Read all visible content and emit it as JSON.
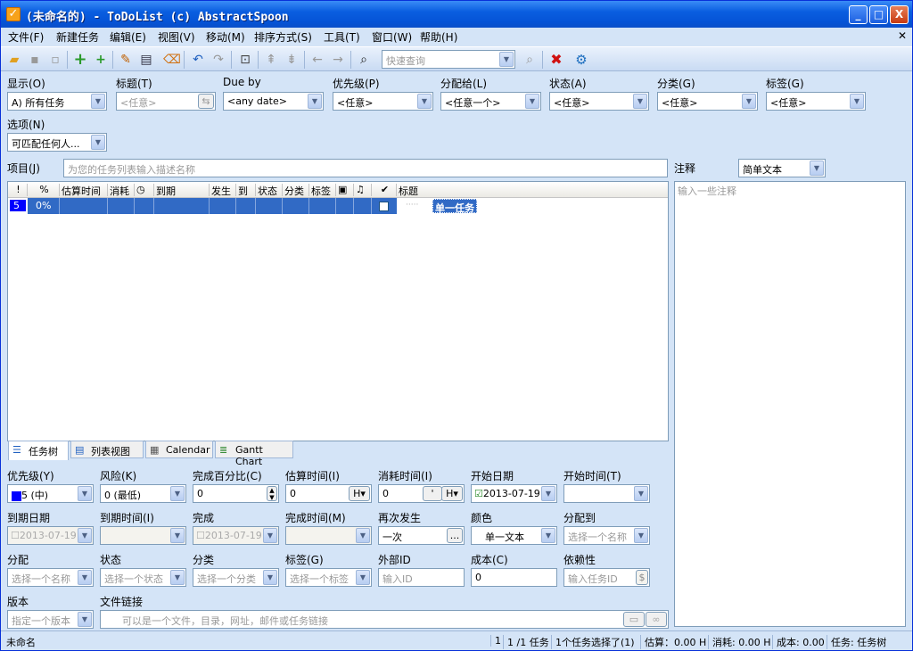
{
  "window": {
    "title": "(未命名的) - ToDoList (c) AbstractSpoon",
    "min": "_",
    "max": "□",
    "close": "X"
  },
  "menu": [
    "文件(F)",
    "新建任务",
    "编辑(E)",
    "视图(V)",
    "移动(M)",
    "排序方式(S)",
    "工具(T)",
    "窗口(W)",
    "帮助(H)"
  ],
  "toolbar": {
    "quick_find_placeholder": "快速查询",
    "icons": [
      "open-folder-icon",
      "save-icon",
      "save-all-icon",
      "add-task-icon",
      "add-subtask-icon",
      "edit-icon",
      "preferences-card-icon",
      "delete-brush-icon",
      "undo-icon",
      "redo-icon",
      "maximize-icon",
      "move-up-icon",
      "move-down-icon",
      "move-left-icon",
      "move-right-icon",
      "find-binoculars-icon",
      "quick-find-icon",
      "delete-icon",
      "settings-gear-icon"
    ]
  },
  "filters": {
    "show_label": "显示(O)",
    "show_value": "A)  所有任务",
    "title_label": "标题(T)",
    "title_placeholder": "<任意>",
    "due_label": "Due by",
    "due_value": "<any date>",
    "priority_label": "优先级(P)",
    "priority_value": "<任意>",
    "assigned_label": "分配给(L)",
    "assigned_value": "<任意一个>",
    "status_label": "状态(A)",
    "status_value": "<任意>",
    "category_label": "分类(G)",
    "category_value": "<任意>",
    "tags_label": "标签(G)",
    "tags_value": "<任意>",
    "options_label": "选项(N)",
    "options_value": "可匹配任何人..."
  },
  "project": {
    "label": "项目(J)",
    "placeholder": "为您的任务列表输入描述名称"
  },
  "comments": {
    "label": "注释",
    "format": "简单文本",
    "placeholder": "输入一些注释"
  },
  "columns": [
    "!",
    "%",
    "估算时间",
    "消耗",
    "◷",
    "到期",
    "发生",
    "到",
    "状态",
    "分类",
    "标签",
    "▣",
    "♫",
    "✔",
    "标题"
  ],
  "task_row": {
    "priority": "5",
    "percent": "0%",
    "dots": "·····",
    "title": "单一任务"
  },
  "tabs": [
    "任务树",
    "列表视图",
    "Calendar",
    "Gantt Chart"
  ],
  "details": {
    "priority_label": "优先级(Y)",
    "priority_value": "5 (中)",
    "risk_label": "风险(K)",
    "risk_value": "0 (最低)",
    "percent_label": "完成百分比(C)",
    "percent_value": "0",
    "estimate_label": "估算时间(I)",
    "estimate_value": "0",
    "estimate_unit": "H▾",
    "spent_label": "消耗时间(I)",
    "spent_value": "0",
    "spent_unit": "H▾",
    "spent_btn": "'",
    "start_date_label": "开始日期",
    "start_date_value": "2013-07-19",
    "start_time_label": "开始时间(T)",
    "start_time_value": "",
    "due_date_label": "到期日期",
    "due_date_value": "2013-07-19",
    "due_time_label": "到期时间(I)",
    "due_time_value": "",
    "done_label": "完成",
    "done_value": "2013-07-19",
    "done_time_label": "完成时间(M)",
    "done_time_value": "",
    "recur_label": "再次发生",
    "recur_value": "一次",
    "recur_btn": "...",
    "color_label": "颜色",
    "color_value": "单一文本",
    "assigned_by_label": "分配到",
    "assigned_by_placeholder": "选择一个名称",
    "assign_label": "分配",
    "assign_placeholder": "选择一个名称",
    "status_label": "状态",
    "status_placeholder": "选择一个状态",
    "category_label": "分类",
    "category_placeholder": "选择一个分类",
    "tags_label": "标签(G)",
    "tags_placeholder": "选择一个标签",
    "ext_id_label": "外部ID",
    "ext_id_placeholder": "输入ID",
    "cost_label": "成本(C)",
    "cost_value": "0",
    "depends_label": "依赖性",
    "depends_placeholder": "输入任务ID",
    "version_label": "版本",
    "version_placeholder": "指定一个版本",
    "file_link_label": "文件链接",
    "file_link_placeholder": "可以是一个文件，目录，网址，邮件或任务链接"
  },
  "status": {
    "file": "未命名",
    "s1": "1",
    "s2": "1 /1 任务",
    "s3": "1个任务选择了(1)",
    "s4": "估算：0.00 H",
    "s5": "消耗: 0.00 H",
    "s6": "成本: 0.00",
    "s7": "任务: 任务树"
  },
  "colors": {
    "selection": "#316ac5",
    "priority5": "#0000ff",
    "titlebar": "#0553d6"
  }
}
